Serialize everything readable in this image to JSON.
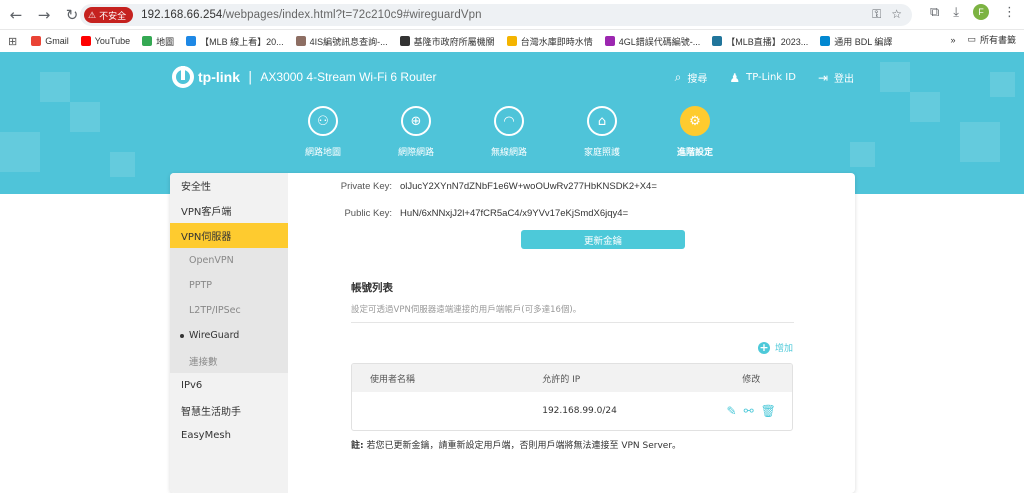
{
  "browser": {
    "insecure_label": "不安全",
    "url_host": "192.168.66.254",
    "url_path": "/webpages/index.html?t=72c210c9#wireguardVpn",
    "avatar_letter": "F",
    "bookmarks": [
      {
        "label": "Gmail",
        "color": "#ea4335"
      },
      {
        "label": "YouTube",
        "color": "#ff0000"
      },
      {
        "label": "地圖",
        "color": "#34a853"
      },
      {
        "label": "【MLB 線上看】20...",
        "color": "#1e88e5"
      },
      {
        "label": "4IS編號訊息查詢-...",
        "color": "#8d6e63"
      },
      {
        "label": "基隆市政府所屬機關",
        "color": "#333333"
      },
      {
        "label": "台灣水庫即時水情",
        "color": "#f4b400"
      },
      {
        "label": "4GL錯誤代碼編號-...",
        "color": "#9c27b0"
      },
      {
        "label": "【MLB直播】2023...",
        "color": "#21759b"
      },
      {
        "label": "通用 BDL 編譯",
        "color": "#0288d1"
      }
    ],
    "bookmarks_folder": "所有書籤"
  },
  "header": {
    "brand": "tp-link",
    "model": "AX3000 4-Stream Wi-Fi 6 Router",
    "links": [
      {
        "label": "搜尋",
        "icon": "search-icon"
      },
      {
        "label": "TP-Link ID",
        "icon": "user-icon"
      },
      {
        "label": "登出",
        "icon": "logout-icon"
      }
    ]
  },
  "nav": {
    "items": [
      {
        "label": "網路地圖",
        "icon": "network-map-icon"
      },
      {
        "label": "網際網路",
        "icon": "globe-icon"
      },
      {
        "label": "無線網路",
        "icon": "wifi-icon"
      },
      {
        "label": "家庭照護",
        "icon": "home-care-icon"
      },
      {
        "label": "進階設定",
        "icon": "gear-icon"
      }
    ],
    "active": "進階設定"
  },
  "sidebar": {
    "items": [
      {
        "label": "安全性"
      },
      {
        "label": "VPN客戶端"
      },
      {
        "label": "VPN伺服器"
      }
    ],
    "sub_items": [
      {
        "label": "OpenVPN"
      },
      {
        "label": "PPTP"
      },
      {
        "label": "L2TP/IPSec"
      },
      {
        "label": "WireGuard"
      },
      {
        "label": "連接數"
      }
    ],
    "after_items": [
      {
        "label": "IPv6"
      },
      {
        "label": "智慧生活助手"
      },
      {
        "label": "EasyMesh"
      }
    ]
  },
  "wireguard": {
    "private_key_label": "Private Key:",
    "private_key_value": "olJucY2XYnN7dZNbF1e6W+woOUwRv277HbKNSDK2+X4=",
    "public_key_label": "Public Key:",
    "public_key_value": "HuN/6xNNxjJ2l+47fCR5aC4/x9YVv17eKjSmdX6jqy4=",
    "refresh_button": "更新金鑰",
    "account_title": "帳號列表",
    "account_desc": "設定可透過VPN伺服器遠端連接的用戶端帳戶(可多達16個)。",
    "add_label": "增加",
    "table": {
      "headers": [
        "使用者名稱",
        "允許的 IP",
        "修改"
      ],
      "rows": [
        {
          "username": "",
          "allowed_ip": "192.168.99.0/24"
        }
      ]
    },
    "note_prefix": "註:",
    "note_text": " 若您已更新金鑰，請重新設定用戶端，否則用戶端將無法連接至 VPN Server。"
  }
}
